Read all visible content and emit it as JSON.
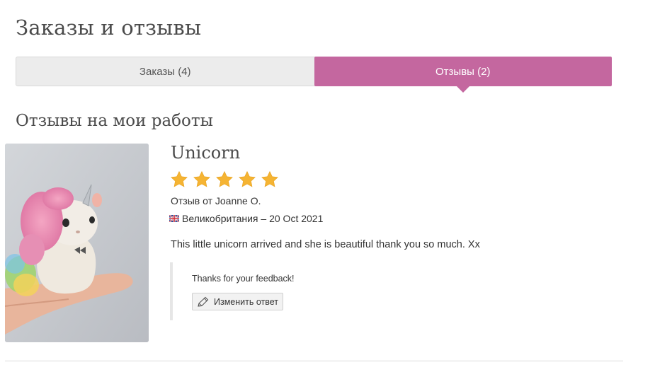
{
  "page": {
    "title": "Заказы и отзывы"
  },
  "tabs": [
    {
      "label": "Заказы (4)",
      "active": false
    },
    {
      "label": "Отзывы (2)",
      "active": true
    }
  ],
  "section": {
    "title": "Отзывы на мои работы"
  },
  "review": {
    "item_title": "Unicorn",
    "rating": 5,
    "rating_max": 5,
    "author": "Отзыв от Joanne O.",
    "country": "Великобритания",
    "separator": "–",
    "date": "20 Oct 2021",
    "text": "This little unicorn arrived and she is beautiful thank you so much. Xx",
    "reply": {
      "text": "Thanks for your feedback!",
      "edit_label": "Изменить ответ"
    }
  },
  "colors": {
    "accent": "#c4679f",
    "star": "#f5b433",
    "tab_bg": "#ececec"
  },
  "icons": {
    "flag": "uk-flag-icon",
    "edit": "pencil-icon",
    "star": "star-icon"
  }
}
